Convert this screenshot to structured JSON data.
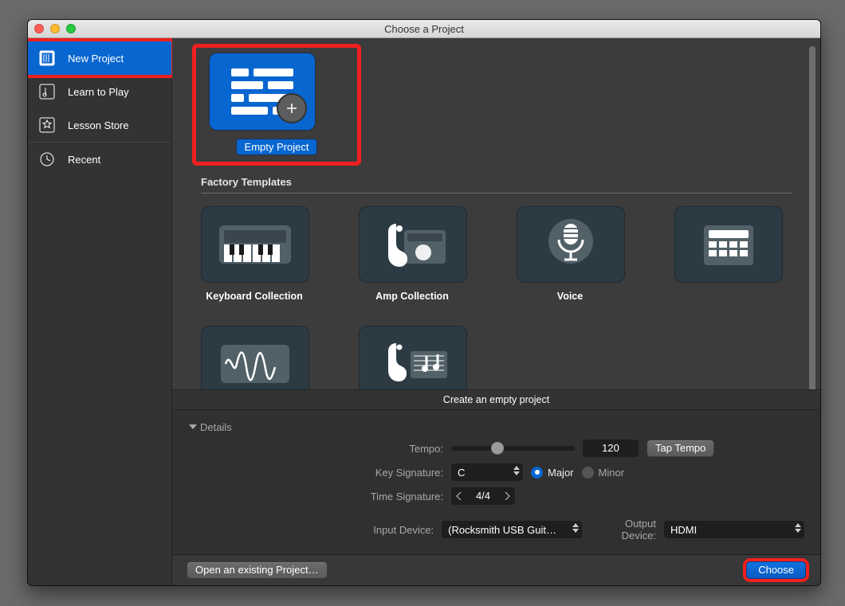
{
  "window": {
    "title": "Choose a Project"
  },
  "sidebar": [
    {
      "label": "New Project",
      "icon": "new-project-icon",
      "selected": true
    },
    {
      "label": "Learn to Play",
      "icon": "learn-to-play-icon"
    },
    {
      "label": "Lesson Store",
      "icon": "lesson-store-icon"
    },
    {
      "label": "Recent",
      "icon": "recent-icon"
    }
  ],
  "templates": {
    "empty": {
      "label": "Empty Project",
      "description": "Create an empty project",
      "selected": true
    },
    "section_label": "Factory Templates",
    "items": [
      {
        "label": "Keyboard Collection"
      },
      {
        "label": "Amp Collection"
      },
      {
        "label": "Voice"
      }
    ]
  },
  "details": {
    "title": "Details",
    "tempo": {
      "label": "Tempo:",
      "value": "120",
      "tap_label": "Tap Tempo"
    },
    "key": {
      "label": "Key Signature:",
      "value": "C",
      "major": "Major",
      "minor": "Minor",
      "mode": "major"
    },
    "timesig": {
      "label": "Time Signature:",
      "value": "4/4"
    },
    "io": {
      "input_label": "Input Device:",
      "input_value": "(Rocksmith USB Guit…",
      "output_label": "Output Device:",
      "output_value": "HDMI"
    }
  },
  "footer": {
    "open_existing": "Open an existing Project…",
    "choose": "Choose"
  },
  "highlights": [
    "sidebar-item-new-project",
    "template-empty-project",
    "choose-button"
  ],
  "colors": {
    "accent": "#0866d0",
    "highlight": "#f02020",
    "panel": "#3c3c3c"
  }
}
